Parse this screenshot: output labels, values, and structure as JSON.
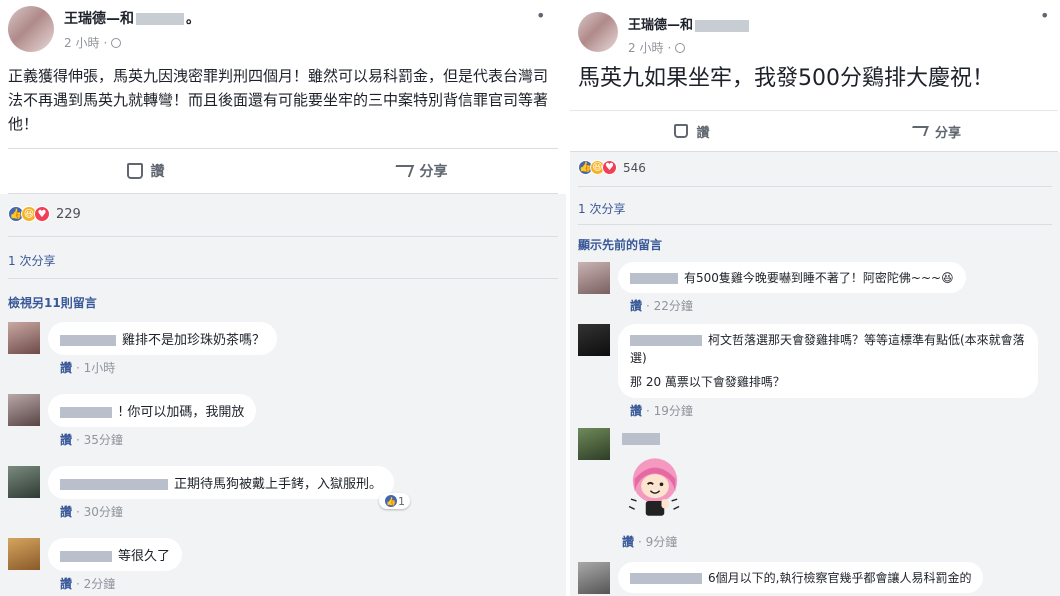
{
  "left_post": {
    "author": "王瑞德",
    "with_prefix": "—和",
    "with_suffix": "。",
    "time": "2 小時",
    "dot": "·",
    "more": "•",
    "text": "正義獲得伸張，馬英九因洩密罪判刑四個月！雖然可以易科罰金，但是代表台灣司法不再遇到馬英九就轉彎！而且後面還有可能要坐牢的三中案特別背信罪官司等著他！",
    "like_label": "讚",
    "share_label": "分享",
    "reaction_count": "229",
    "shares": "1 次分享",
    "view_more": "檢視另11則留言",
    "comments": [
      {
        "text": "雞排不是加珍珠奶茶嗎？",
        "like": "讚",
        "time": "1小時"
      },
      {
        "text": "! 你可以加碼，我開放",
        "like": "讚",
        "time": "35分鐘"
      },
      {
        "text": "正期待馬狗被戴上手銬，入獄服刑。",
        "like": "讚",
        "time": "30分鐘",
        "reactions": "1"
      },
      {
        "text": "等很久了",
        "like": "讚",
        "time": "2分鐘"
      }
    ]
  },
  "right_post": {
    "author": "王瑞德",
    "with_prefix": "—和",
    "time": "2 小時",
    "dot": "·",
    "more": "•",
    "text": "馬英九如果坐牢，我發500分鷄排大慶祝！",
    "like_label": "讚",
    "share_label": "分享",
    "reaction_count": "546",
    "shares": "1 次分享",
    "view_previous": "顯示先前的留言",
    "comments": [
      {
        "text": "有500隻雞今晚要嚇到睡不著了！阿密陀佛~~~😆",
        "like": "讚",
        "time": "22分鐘"
      },
      {
        "text": "柯文哲落選那天會發雞排嗎？等等這標準有點低(本來就會落選)",
        "text2": "那 20 萬票以下會發雞排嗎？",
        "like": "讚",
        "time": "19分鐘"
      },
      {
        "text": "",
        "like": "讚",
        "time": "9分鐘"
      },
      {
        "text": "6個月以下的,執行檢察官幾乎都會讓人易科罰金的"
      }
    ]
  },
  "colors": {
    "link": "#385898",
    "meta": "#90949c",
    "like_blue": "#4267b2",
    "haha": "#f7b125",
    "love": "#f33e58",
    "comment_bg": "#f2f3f5"
  }
}
